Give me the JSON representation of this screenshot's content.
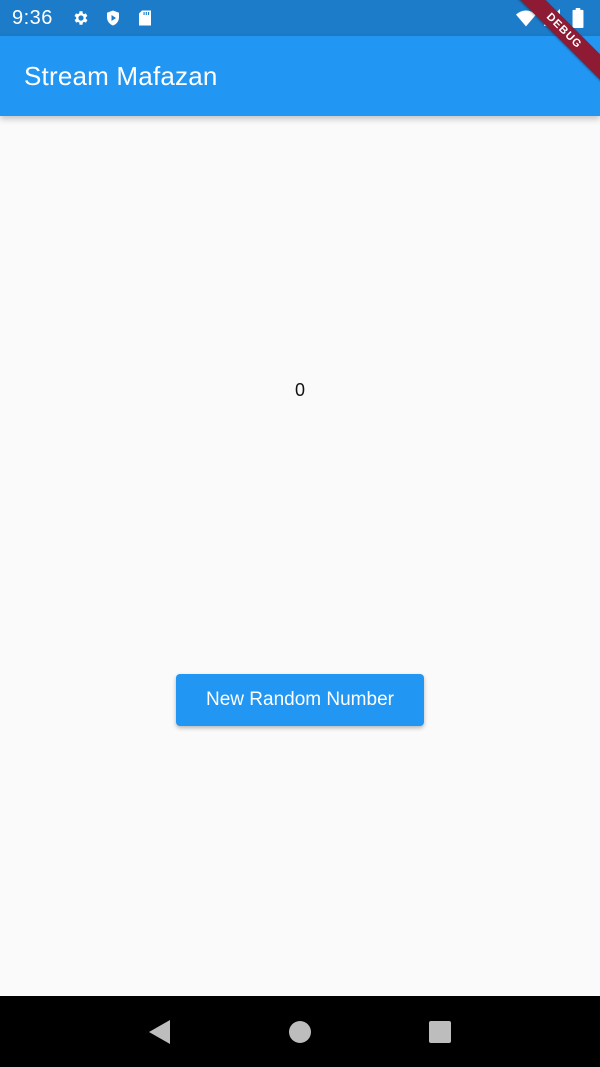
{
  "status_bar": {
    "time": "9:36",
    "left_icons": [
      "gear-icon",
      "play-shield-icon",
      "sd-card-icon"
    ],
    "right_icons": [
      "wifi-icon",
      "signal-icon",
      "battery-icon"
    ]
  },
  "debug_banner": {
    "label": "DEBUG"
  },
  "app_bar": {
    "title": "Stream Mafazan"
  },
  "main": {
    "number": "0",
    "button_label": "New Random Number"
  },
  "nav_bar": {
    "icons": [
      "back-icon",
      "home-icon",
      "recents-icon"
    ]
  },
  "colors": {
    "primary": "#2196f3",
    "status_bar": "#1c7cc9",
    "background": "#fafafa",
    "debug": "#8e1a33"
  }
}
